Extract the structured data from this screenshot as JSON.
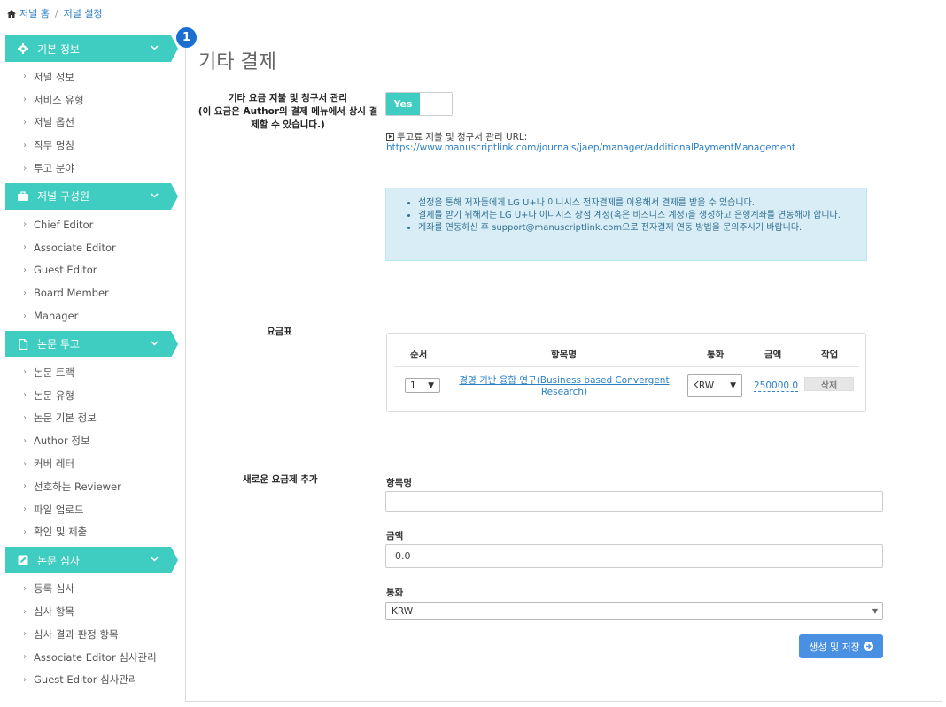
{
  "breadcrumb": {
    "home": "저널 홈",
    "current": "저널 설정"
  },
  "badge": "1",
  "sidebar": {
    "sections": [
      {
        "title": "기본 정보",
        "icon": "gear-icon",
        "items": [
          "저널 정보",
          "서비스 유형",
          "저널 옵션",
          "직무 명칭",
          "투고 분야"
        ]
      },
      {
        "title": "저널 구성원",
        "icon": "briefcase-icon",
        "items": [
          "Chief Editor",
          "Associate Editor",
          "Guest Editor",
          "Board Member",
          "Manager"
        ]
      },
      {
        "title": "논문 투고",
        "icon": "document-icon",
        "items": [
          "논문 트랙",
          "논문 유형",
          "논문 기본 정보",
          "Author 정보",
          "커버 레터",
          "선호하는 Reviewer",
          "파일 업로드",
          "확인 및 제출"
        ]
      },
      {
        "title": "논문 심사",
        "icon": "edit-icon",
        "items": [
          "등록 심사",
          "심사 항목",
          "심사 결과 판정 항목",
          "Associate Editor 심사관리",
          "Guest Editor 심사관리"
        ]
      }
    ]
  },
  "main": {
    "title": "기타 결제",
    "fee_setting": {
      "label_line1": "기타 요금 지불 및 청구서 관리",
      "label_line2": "(이 요금은 Author의 결제 메뉴에서 상시 결",
      "label_line3": "제할 수 있습니다.)",
      "toggle_value": "Yes",
      "url_label": "투고료 지불 및 청구서 관리 URL:",
      "url": "https://www.manuscriptlink.com/journals/jaep/manager/additionalPaymentManagement"
    },
    "info": [
      "설정을 통해 저자들에게 LG U+나 이니시스 전자결제를 이용해서 결제를 받을 수 있습니다.",
      "결제를 받기 위해서는 LG U+나 이니시스 상점 계정(혹은 비즈니스 계정)을 생성하고 은행계좌를 연동해야 합니다.",
      "계좌를 연동하신 후 support@manuscriptlink.com으로 전자결제 연동 방법을 문의주시기 바랍니다."
    ],
    "fee_table": {
      "label": "요금표",
      "headers": {
        "order": "순서",
        "name": "항목명",
        "currency": "통화",
        "amount": "금액",
        "action": "작업"
      },
      "rows": [
        {
          "order": "1",
          "name": "경영 기반 융합 연구(Business based Convergent Research)",
          "currency": "KRW",
          "amount": "250000.0",
          "action": "삭제"
        }
      ]
    },
    "new_fee": {
      "label": "새로운 요금제 추가",
      "name_label": "항목명",
      "name_value": "",
      "amount_label": "금액",
      "amount_value": "0.0",
      "currency_label": "통화",
      "currency_value": "KRW",
      "submit": "생성 및 저장"
    }
  },
  "colors": {
    "accent": "#3ecdc0",
    "link": "#2a7fc7",
    "button": "#4a90e2",
    "info_bg": "#d9edf7",
    "badge": "#1a6fd1"
  }
}
